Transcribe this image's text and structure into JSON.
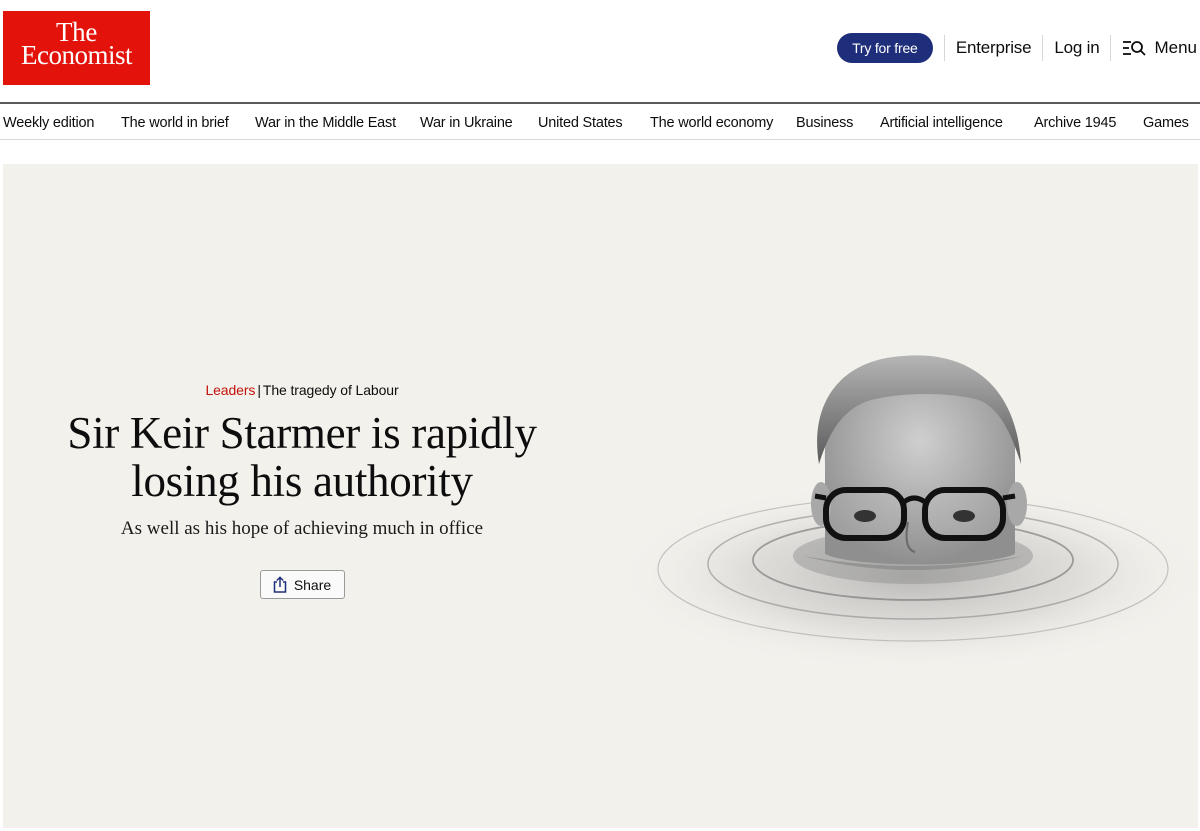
{
  "brand": {
    "line1": "The",
    "line2": "Economist",
    "color": "#e3120b"
  },
  "header": {
    "try_label": "Try for free",
    "enterprise_label": "Enterprise",
    "login_label": "Log in",
    "menu_label": "Menu",
    "accent": "#1f2e7a"
  },
  "nav": {
    "items": [
      "Weekly edition",
      "The world in brief",
      "War in the Middle East",
      "War in Ukraine",
      "United States",
      "The world economy",
      "Business",
      "Artificial intelligence",
      "Archive 1945",
      "Games"
    ]
  },
  "article": {
    "section": "Leaders",
    "separator": "|",
    "topic": "The tragedy of Labour",
    "headline": "Sir Keir Starmer is rapidly losing his authority",
    "standfirst": "As well as his hope of achieving much in office",
    "share_label": "Share",
    "section_color": "#c3120b"
  },
  "icons": {
    "menu": "menu-search-icon",
    "share": "share-icon"
  }
}
